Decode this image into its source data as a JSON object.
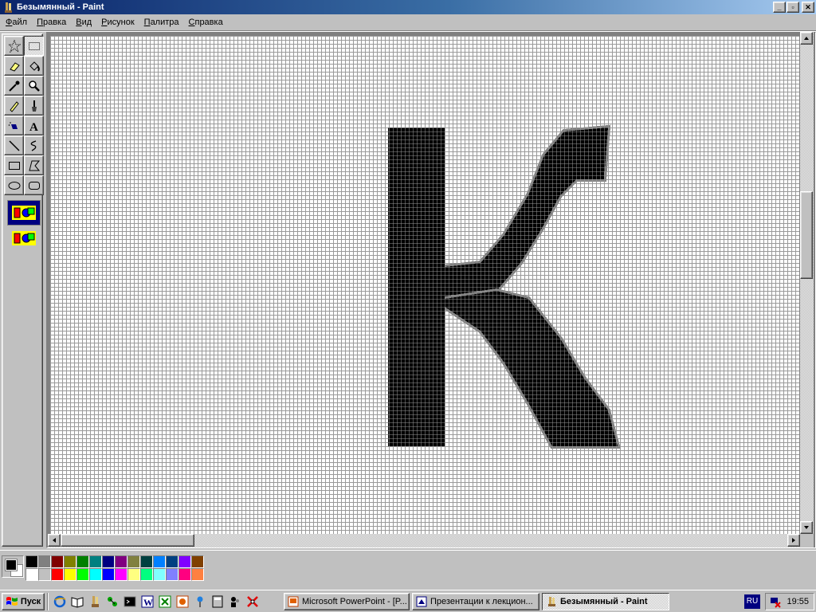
{
  "window": {
    "title": "Безымянный - Paint",
    "controls": {
      "minimize": "_",
      "maximize": "▫",
      "close": "✕"
    }
  },
  "menu": [
    {
      "label": "Файл",
      "accel": "Ф",
      "rest": "айл"
    },
    {
      "label": "Правка",
      "accel": "П",
      "rest": "равка"
    },
    {
      "label": "Вид",
      "accel": "В",
      "rest": "ид"
    },
    {
      "label": "Рисунок",
      "accel": "Р",
      "rest": "исунок"
    },
    {
      "label": "Палитра",
      "accel": "П",
      "rest": "алитра"
    },
    {
      "label": "Справка",
      "accel": "С",
      "rest": "правка"
    }
  ],
  "canvas": {
    "letter": "К",
    "grid_color": "#9a9a9a",
    "ink_color": "#000000",
    "antialias_color": "#808080"
  },
  "colors": {
    "foreground": "#000000",
    "background": "#ffffff",
    "palette": [
      "#000000",
      "#808080",
      "#800000",
      "#808000",
      "#008000",
      "#008080",
      "#000080",
      "#800080",
      "#808040",
      "#004040",
      "#0080ff",
      "#004080",
      "#8000ff",
      "#804000",
      "#ffffff",
      "#c0c0c0",
      "#ff0000",
      "#ffff00",
      "#00ff00",
      "#00ffff",
      "#0000ff",
      "#ff00ff",
      "#ffff80",
      "#00ff80",
      "#80ffff",
      "#8080ff",
      "#ff0080",
      "#ff8040"
    ]
  },
  "taskbar": {
    "start_label": "Пуск",
    "tasks": [
      {
        "label": "Microsoft PowerPoint - [P...",
        "icon": "powerpoint-icon",
        "active": false
      },
      {
        "label": "Презентации к лекцион...",
        "icon": "presentation-icon",
        "active": false
      },
      {
        "label": "Безымянный - Paint",
        "icon": "paint-icon",
        "active": true
      }
    ],
    "language": "RU",
    "clock": "19:55"
  }
}
